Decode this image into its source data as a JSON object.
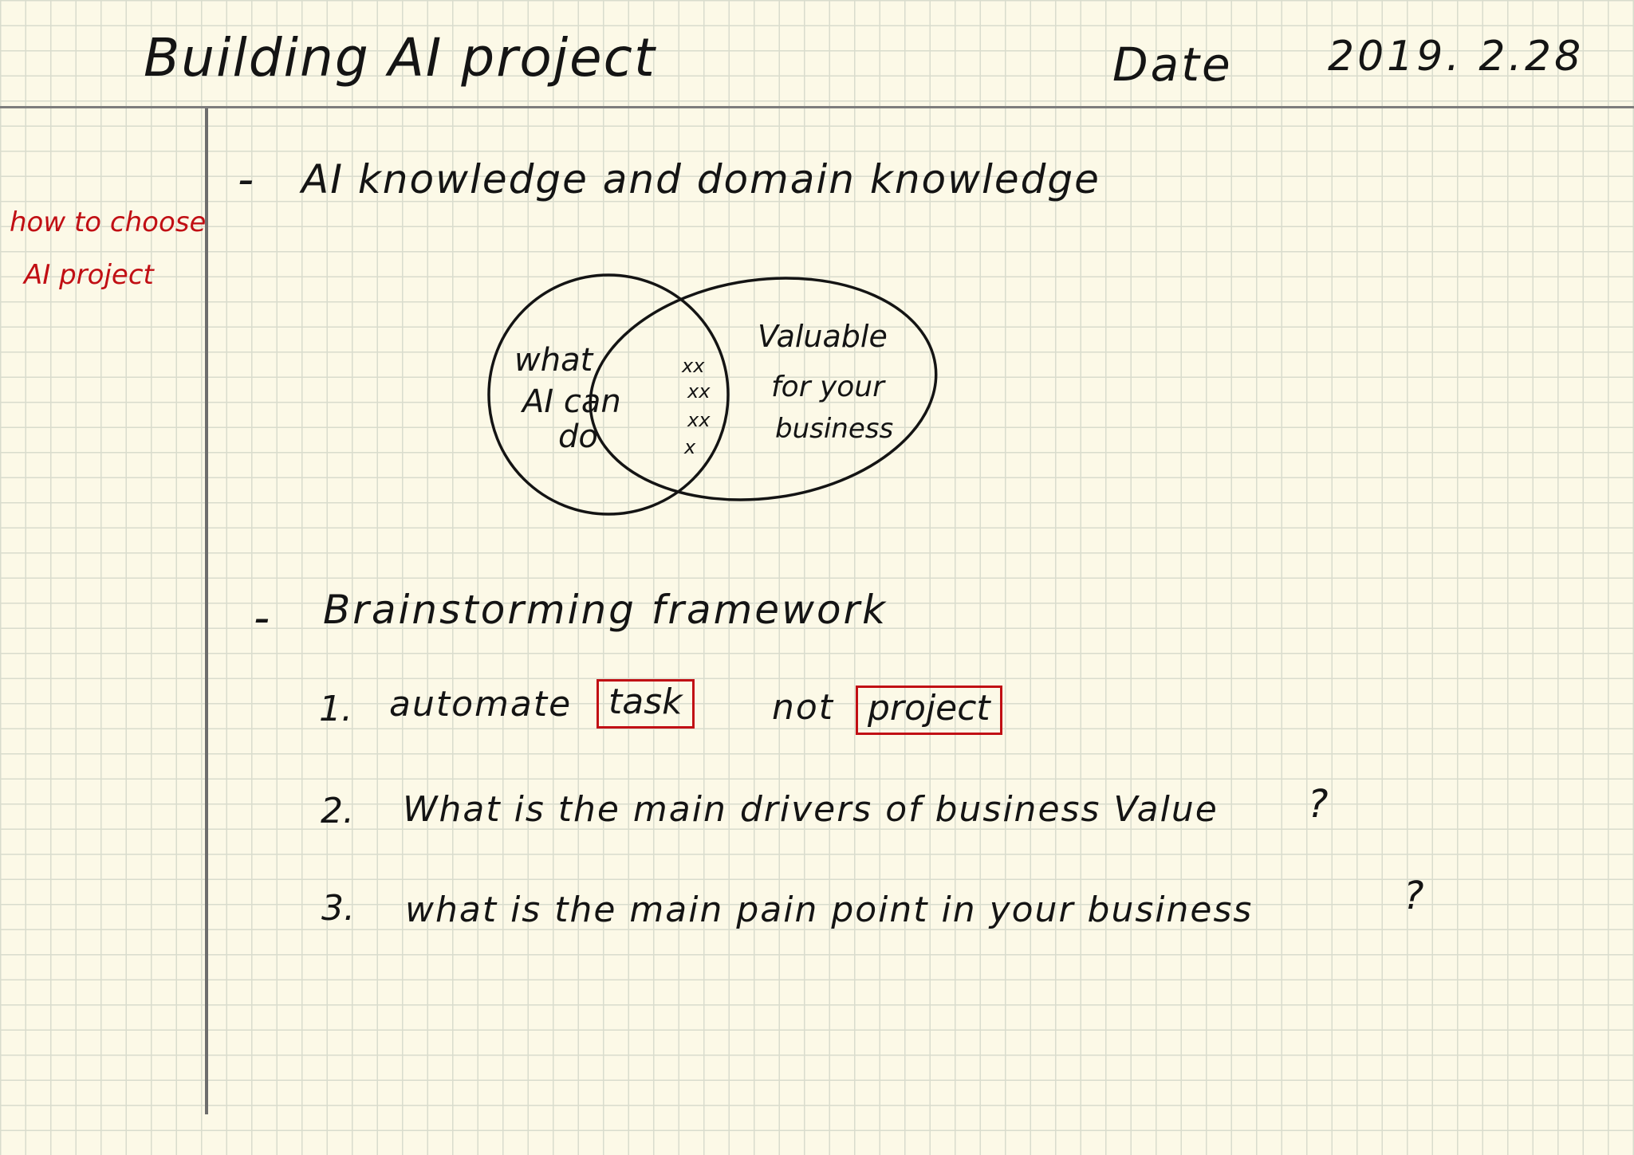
{
  "header": {
    "title": "Building AI project",
    "date_label": "Date",
    "date_value": "2019. 2.28"
  },
  "margin_note": {
    "line1": "how to choose",
    "line2": "AI project",
    "color": "#c10f14"
  },
  "section1": {
    "bullet": "-",
    "heading": "AI knowledge and domain knowledge",
    "venn": {
      "left_circle": [
        "what",
        "AI can",
        "do"
      ],
      "overlap_marks": [
        "xx",
        "xx",
        "xx",
        "x"
      ],
      "right_circle": [
        "Valuable",
        "for your",
        "business"
      ]
    }
  },
  "section2": {
    "bullet": "-",
    "heading": "Brainstorming framework",
    "items": [
      {
        "number": "1.",
        "text_before": "automate",
        "boxed_1": "task",
        "text_middle": "not",
        "boxed_2": "project"
      },
      {
        "number": "2.",
        "text": "What is the main drivers of business Value",
        "mark": "?"
      },
      {
        "number": "3.",
        "text": "what is the main pain point in your business",
        "mark": "?"
      }
    ]
  }
}
